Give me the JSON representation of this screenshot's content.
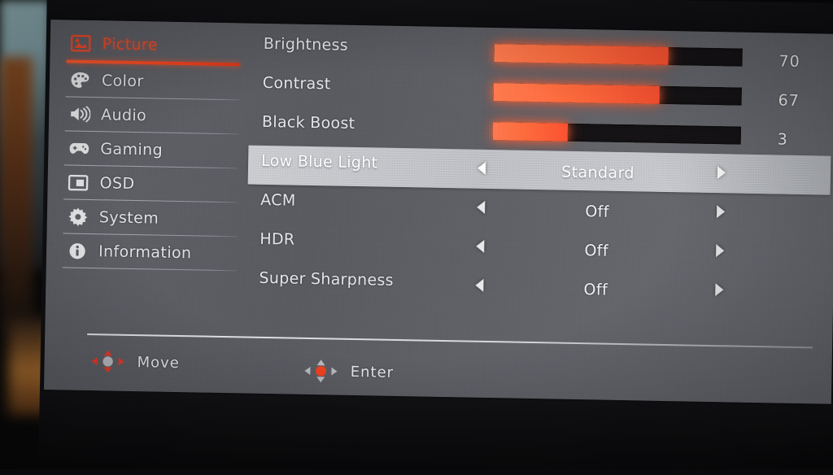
{
  "osd": {
    "device": "Monitor OSD Menu",
    "active_page": "Picture",
    "sidebar": {
      "items": [
        {
          "label": "Picture",
          "icon": "picture-icon",
          "active": true
        },
        {
          "label": "Color",
          "icon": "palette-icon",
          "active": false
        },
        {
          "label": "Audio",
          "icon": "speaker-icon",
          "active": false
        },
        {
          "label": "Gaming",
          "icon": "gamepad-icon",
          "active": false
        },
        {
          "label": "OSD",
          "icon": "osd-panel-icon",
          "active": false
        },
        {
          "label": "System",
          "icon": "gear-icon",
          "active": false
        },
        {
          "label": "Information",
          "icon": "info-circle-icon",
          "active": false
        }
      ]
    },
    "settings": [
      {
        "label": "Brightness",
        "type": "slider",
        "value": 70,
        "percent": 70,
        "highlight": false
      },
      {
        "label": "Contrast",
        "type": "slider",
        "value": 67,
        "percent": 67,
        "highlight": false
      },
      {
        "label": "Black Boost",
        "type": "slider",
        "value": 3,
        "percent": 30,
        "highlight": false
      },
      {
        "label": "Low Blue Light",
        "type": "option",
        "value": "Standard",
        "highlight": true
      },
      {
        "label": "ACM",
        "type": "option",
        "value": "Off",
        "highlight": false
      },
      {
        "label": "HDR",
        "type": "option",
        "value": "Off",
        "highlight": false
      },
      {
        "label": "Super Sharpness",
        "type": "option",
        "value": "Off",
        "highlight": false
      }
    ],
    "footer": {
      "hints": [
        {
          "label": "Move",
          "icon": "dpad-move-icon"
        },
        {
          "label": "Enter",
          "icon": "dpad-enter-icon"
        }
      ]
    },
    "colors": {
      "accent": "#f04a2a",
      "slider_fill": "#ff6a3c",
      "slider_track": "#141214",
      "panel_bg": "#5f6167",
      "highlight_bg": "#c4c6cb",
      "text": "#e6e8ea"
    }
  }
}
